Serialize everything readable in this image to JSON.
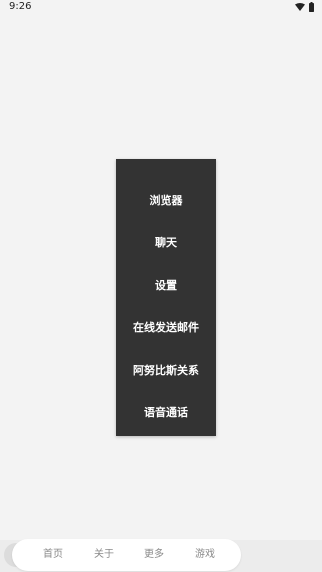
{
  "status_bar": {
    "time": "9:26",
    "icons": [
      "wifi-icon",
      "battery-icon"
    ]
  },
  "menu": {
    "items": [
      {
        "label": "浏览器"
      },
      {
        "label": "聊天"
      },
      {
        "label": "设置"
      },
      {
        "label": "在线发送邮件"
      },
      {
        "label": "阿努比斯关系"
      },
      {
        "label": "语音通话"
      }
    ]
  },
  "bottom_nav": {
    "items": [
      {
        "label": "首页"
      },
      {
        "label": "关于"
      },
      {
        "label": "更多"
      },
      {
        "label": "游戏"
      }
    ]
  },
  "colors": {
    "background": "#f3f3f3",
    "menu_background": "#333333",
    "menu_text": "#ffffff",
    "nav_text": "#8a8a8a"
  }
}
